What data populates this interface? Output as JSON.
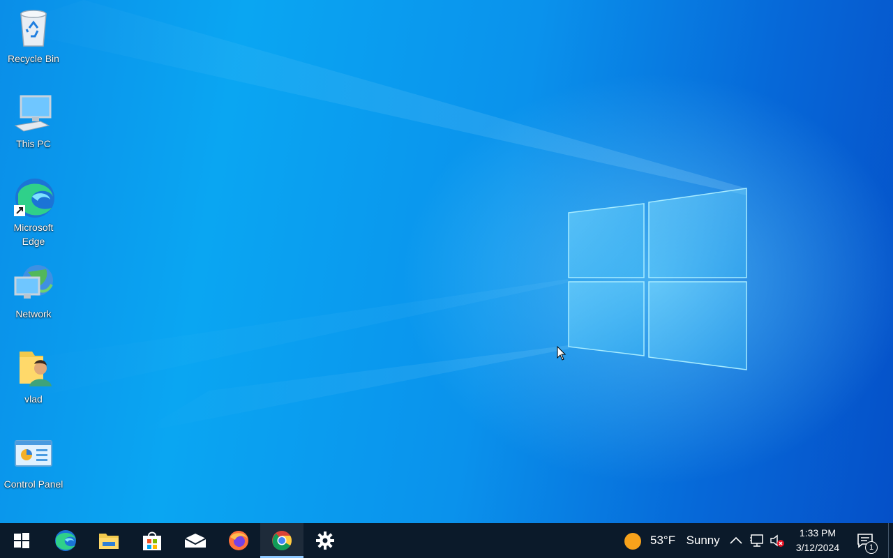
{
  "desktop": {
    "icons": [
      {
        "label": "Recycle Bin",
        "icon": "recycle-bin-icon"
      },
      {
        "label": "This PC",
        "icon": "computer-icon"
      },
      {
        "label": "Microsoft Edge",
        "icon": "edge-icon"
      },
      {
        "label": "Network",
        "icon": "network-icon"
      },
      {
        "label": "vlad",
        "icon": "user-folder-icon"
      },
      {
        "label": "Control Panel",
        "icon": "control-panel-icon"
      }
    ],
    "colors": {
      "wallpaper_light": "#0aa6f2",
      "wallpaper_dark": "#0550c8"
    }
  },
  "taskbar": {
    "apps": [
      {
        "name": "Start",
        "icon": "windows-start-icon",
        "active": false
      },
      {
        "name": "Microsoft Edge",
        "icon": "edge-icon",
        "active": false
      },
      {
        "name": "File Explorer",
        "icon": "folder-icon",
        "active": false
      },
      {
        "name": "Microsoft Store",
        "icon": "store-bag-icon",
        "active": false
      },
      {
        "name": "Mail",
        "icon": "mail-icon",
        "active": false
      },
      {
        "name": "Firefox",
        "icon": "firefox-icon",
        "active": false
      },
      {
        "name": "Google Chrome",
        "icon": "chrome-icon",
        "active": true
      },
      {
        "name": "Settings",
        "icon": "gear-icon",
        "active": false
      }
    ],
    "weather": {
      "temperature": "53°F",
      "condition": "Sunny",
      "icon": "sun-icon"
    },
    "tray": {
      "icons": [
        "chevron-up-icon",
        "network-monitor-icon",
        "speaker-muted-icon"
      ]
    },
    "clock": {
      "time": "1:33 PM",
      "date": "3/12/2024"
    },
    "notifications": {
      "count": "1",
      "icon": "action-center-icon"
    },
    "colors": {
      "background": "#0b1a2a",
      "active_indicator": "#8ec8ff"
    }
  }
}
